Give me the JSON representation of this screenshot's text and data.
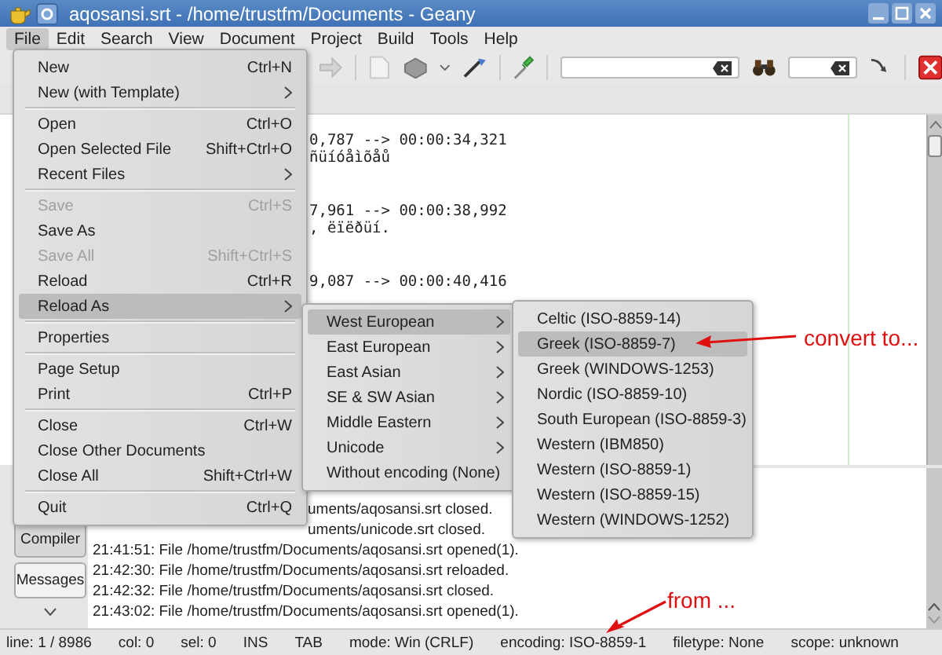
{
  "window": {
    "title": "aqosansi.srt - /home/trustfm/Documents - Geany"
  },
  "menubar": [
    {
      "label": "File",
      "selected": true
    },
    {
      "label": "Edit",
      "selected": false
    },
    {
      "label": "Search",
      "selected": false
    },
    {
      "label": "View",
      "selected": false
    },
    {
      "label": "Document",
      "selected": false
    },
    {
      "label": "Project",
      "selected": false
    },
    {
      "label": "Build",
      "selected": false
    },
    {
      "label": "Tools",
      "selected": false
    },
    {
      "label": "Help",
      "selected": false
    }
  ],
  "editor": {
    "entries": [
      {
        "timing": "0,787 --> 00:00:34,321",
        "text": "ñüíóåìõåů"
      },
      {
        "timing": "7,961 --> 00:00:38,992",
        "text": ", ëïëðüí."
      },
      {
        "timing": "9,087 --> 00:00:40,416"
      }
    ]
  },
  "messages": {
    "tabs": [
      {
        "label": "Compiler",
        "selected": false
      },
      {
        "label": "Messages",
        "selected": true
      }
    ],
    "lines": [
      "uments/aqosansi.srt closed.",
      "uments/unicode.srt closed.",
      "21:41:51: File /home/trustfm/Documents/aqosansi.srt opened(1).",
      "21:42:30: File /home/trustfm/Documents/aqosansi.srt reloaded.",
      "21:42:32: File /home/trustfm/Documents/aqosansi.srt closed.",
      "21:43:02: File /home/trustfm/Documents/aqosansi.srt opened(1)."
    ]
  },
  "status_bar": [
    "line: 1 / 8986",
    "col: 0",
    "sel: 0",
    "INS",
    "TAB",
    "mode: Win (CRLF)",
    "encoding: ISO-8859-1",
    "filetype: None",
    "scope: unknown"
  ],
  "file_menu": {
    "items": [
      {
        "kind": "item",
        "label": "New",
        "shortcut": "Ctrl+N",
        "disabled": false,
        "selected": false,
        "has_submenu": false
      },
      {
        "kind": "item",
        "label": "New (with Template)",
        "disabled": false,
        "selected": false,
        "has_submenu": true
      },
      {
        "kind": "separator"
      },
      {
        "kind": "item",
        "label": "Open",
        "shortcut": "Ctrl+O",
        "disabled": false,
        "selected": false,
        "has_submenu": false
      },
      {
        "kind": "item",
        "label": "Open Selected File",
        "shortcut": "Shift+Ctrl+O",
        "disabled": false,
        "selected": false,
        "has_submenu": false
      },
      {
        "kind": "item",
        "label": "Recent Files",
        "disabled": false,
        "selected": false,
        "has_submenu": true
      },
      {
        "kind": "separator"
      },
      {
        "kind": "item",
        "label": "Save",
        "shortcut": "Ctrl+S",
        "disabled": true,
        "selected": false,
        "has_submenu": false
      },
      {
        "kind": "item",
        "label": "Save As",
        "disabled": false,
        "selected": false,
        "has_submenu": false
      },
      {
        "kind": "item",
        "label": "Save All",
        "shortcut": "Shift+Ctrl+S",
        "disabled": true,
        "selected": false,
        "has_submenu": false
      },
      {
        "kind": "item",
        "label": "Reload",
        "shortcut": "Ctrl+R",
        "disabled": false,
        "selected": false,
        "has_submenu": false
      },
      {
        "kind": "item",
        "label": "Reload As",
        "disabled": false,
        "selected": true,
        "has_submenu": true
      },
      {
        "kind": "separator"
      },
      {
        "kind": "item",
        "label": "Properties",
        "disabled": false,
        "selected": false,
        "has_submenu": false
      },
      {
        "kind": "separator"
      },
      {
        "kind": "item",
        "label": "Page Setup",
        "disabled": false,
        "selected": false,
        "has_submenu": false
      },
      {
        "kind": "item",
        "label": "Print",
        "shortcut": "Ctrl+P",
        "disabled": false,
        "selected": false,
        "has_submenu": false
      },
      {
        "kind": "separator"
      },
      {
        "kind": "item",
        "label": "Close",
        "shortcut": "Ctrl+W",
        "disabled": false,
        "selected": false,
        "has_submenu": false
      },
      {
        "kind": "item",
        "label": "Close Other Documents",
        "disabled": false,
        "selected": false,
        "has_submenu": false
      },
      {
        "kind": "item",
        "label": "Close All",
        "shortcut": "Shift+Ctrl+W",
        "disabled": false,
        "selected": false,
        "has_submenu": false
      },
      {
        "kind": "separator"
      },
      {
        "kind": "item",
        "label": "Quit",
        "shortcut": "Ctrl+Q",
        "disabled": false,
        "selected": false,
        "has_submenu": false
      }
    ]
  },
  "reload_as_menu": {
    "items": [
      {
        "label": "West European",
        "selected": true,
        "has_submenu": true
      },
      {
        "label": "East European",
        "selected": false,
        "has_submenu": true
      },
      {
        "label": "East Asian",
        "selected": false,
        "has_submenu": true
      },
      {
        "label": "SE & SW Asian",
        "selected": false,
        "has_submenu": true
      },
      {
        "label": "Middle Eastern",
        "selected": false,
        "has_submenu": true
      },
      {
        "label": "Unicode",
        "selected": false,
        "has_submenu": true
      },
      {
        "label": "Without encoding (None)",
        "selected": false,
        "has_submenu": false
      }
    ]
  },
  "encoding_menu": {
    "items": [
      {
        "label": "Celtic (ISO-8859-14)",
        "selected": false
      },
      {
        "label": "Greek (ISO-8859-7)",
        "selected": true
      },
      {
        "label": "Greek (WINDOWS-1253)",
        "selected": false
      },
      {
        "label": "Nordic (ISO-8859-10)",
        "selected": false
      },
      {
        "label": "South European (ISO-8859-3)",
        "selected": false
      },
      {
        "label": "Western (IBM850)",
        "selected": false
      },
      {
        "label": "Western (ISO-8859-1)",
        "selected": false
      },
      {
        "label": "Western (ISO-8859-15)",
        "selected": false
      },
      {
        "label": "Western (WINDOWS-1252)",
        "selected": false
      }
    ]
  },
  "annotations": [
    {
      "text": "convert to..."
    },
    {
      "text": "from ..."
    }
  ]
}
